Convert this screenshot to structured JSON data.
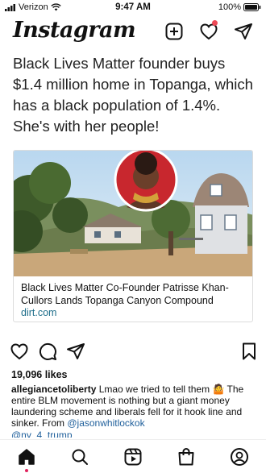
{
  "status_bar": {
    "carrier": "Verizon",
    "time": "9:47 AM",
    "battery": "100%"
  },
  "header": {
    "logo": "Instagram",
    "icons": [
      "new-post-icon",
      "activity-icon",
      "direct-message-icon"
    ],
    "notification_color": "#ed4956"
  },
  "post": {
    "text": "Black Lives Matter founder buys $1.4 million home in Topanga, which has a black population of 1.4%. She's with her people!",
    "link_card": {
      "title": "Black Lives Matter Co-Founder Patrisse Khan-Cullors Lands Topanga Canyon Compound",
      "domain": "dirt.com"
    },
    "likes": "19,096 likes",
    "caption": {
      "username": "allegiancetoliberty",
      "text_before": " Lmao we tried to tell them 🤷 The entire BLM movement is nothing but a giant money laundering scheme and liberals fell for it hook line and sinker. From ",
      "mention": "@jasonwhitlockok",
      "next_mention": "@ny_4_trump"
    }
  },
  "bottom_nav": {
    "items": [
      "home-icon",
      "search-icon",
      "reels-icon",
      "shop-icon",
      "profile-icon"
    ],
    "active": "home-icon",
    "accent": "#e0245e"
  }
}
